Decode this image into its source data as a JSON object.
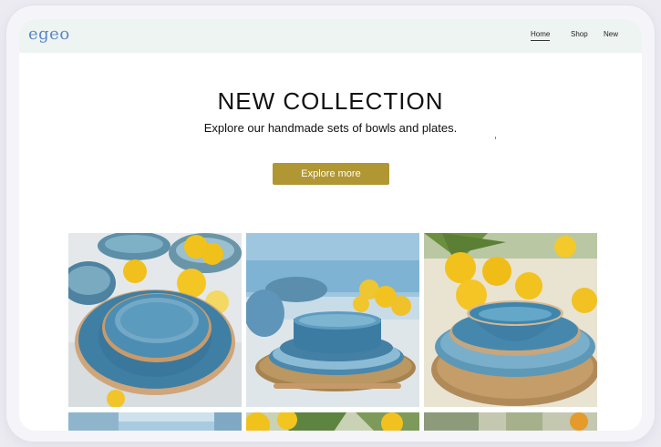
{
  "brand": {
    "logo": "egeo"
  },
  "nav": {
    "items": [
      {
        "label": "Home",
        "active": true
      },
      {
        "label": "Shop",
        "active": false
      },
      {
        "label": "New",
        "active": false
      }
    ]
  },
  "hero": {
    "title": "NEW COLLECTION",
    "subtitle": "Explore our handmade sets of bowls and plates.",
    "cta_label": "Explore more"
  },
  "colors": {
    "accent": "#b19733",
    "logo": "#5a87c8",
    "nav_background": "#eef4f2",
    "glaze_blue": "#4f8fb4",
    "lemon": "#f2c21c"
  }
}
